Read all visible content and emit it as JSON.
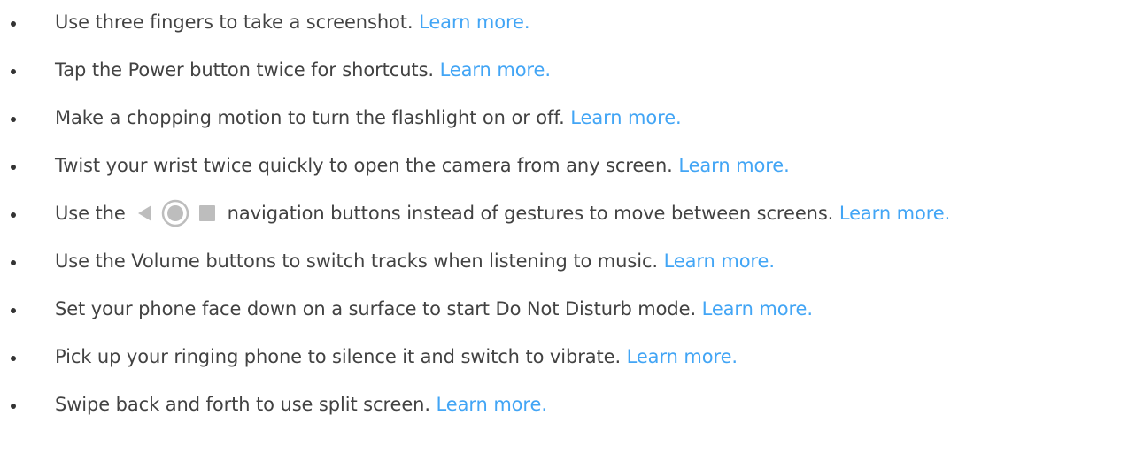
{
  "tips": [
    {
      "text": "Use three fingers to take a screenshot.",
      "link": "Learn more."
    },
    {
      "text": "Tap the Power button twice for shortcuts.",
      "link": "Learn more."
    },
    {
      "text": "Make a chopping motion to turn the flashlight on or off.",
      "link": "Learn more."
    },
    {
      "text": "Twist your wrist twice quickly to open the camera from any screen.",
      "link": "Learn more."
    },
    {
      "text_before": "Use the",
      "text_after": "navigation buttons instead of gestures to move between screens.",
      "link": "Learn more.",
      "icons": [
        "back-triangle-icon",
        "home-circle-icon",
        "recents-square-icon"
      ]
    },
    {
      "text": "Use the Volume buttons to switch tracks when listening to music.",
      "link": "Learn more."
    },
    {
      "text": "Set your phone face down on a surface to start Do Not Disturb mode.",
      "link": "Learn more."
    },
    {
      "text": "Pick up your ringing phone to silence it and switch to vibrate.",
      "link": "Learn more."
    },
    {
      "text": "Swipe back and forth to use split screen.",
      "link": "Learn more."
    }
  ],
  "colors": {
    "text": "#424242",
    "link": "#42a5f5",
    "icon": "#bdbdbd"
  }
}
